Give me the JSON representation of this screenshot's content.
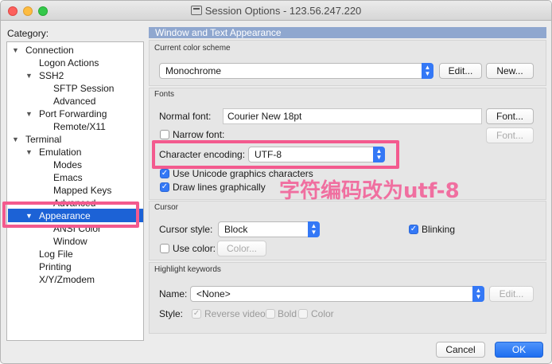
{
  "window": {
    "title": "Session Options - 123.56.247.220"
  },
  "category_label": "Category:",
  "tree": [
    {
      "label": "Connection",
      "arrow": "▼"
    },
    {
      "label": "Logon Actions",
      "arrow": ""
    },
    {
      "label": "SSH2",
      "arrow": "▼"
    },
    {
      "label": "SFTP Session",
      "arrow": ""
    },
    {
      "label": "Advanced",
      "arrow": ""
    },
    {
      "label": "Port Forwarding",
      "arrow": "▼"
    },
    {
      "label": "Remote/X11",
      "arrow": ""
    },
    {
      "label": "Terminal",
      "arrow": "▼"
    },
    {
      "label": "Emulation",
      "arrow": "▼"
    },
    {
      "label": "Modes",
      "arrow": ""
    },
    {
      "label": "Emacs",
      "arrow": ""
    },
    {
      "label": "Mapped Keys",
      "arrow": ""
    },
    {
      "label": "Advanced",
      "arrow": ""
    },
    {
      "label": "Appearance",
      "arrow": "▼",
      "selected": true
    },
    {
      "label": "ANSI Color",
      "arrow": ""
    },
    {
      "label": "Window",
      "arrow": ""
    },
    {
      "label": "Log File",
      "arrow": ""
    },
    {
      "label": "Printing",
      "arrow": ""
    },
    {
      "label": "X/Y/Zmodem",
      "arrow": ""
    }
  ],
  "panel": {
    "header": "Window and Text Appearance",
    "color_scheme": {
      "title": "Current color scheme",
      "value": "Monochrome",
      "edit_label": "Edit...",
      "new_label": "New..."
    },
    "fonts": {
      "title": "Fonts",
      "normal_font_label": "Normal font:",
      "normal_font_value": "Courier New 18pt",
      "font_button": "Font...",
      "narrow_font_label": "Narrow font:",
      "narrow_font_button": "Font...",
      "encoding_label": "Character encoding:",
      "encoding_value": "UTF-8",
      "unicode_graphics_label": "Use Unicode graphics characters",
      "draw_lines_label": "Draw lines graphically"
    },
    "cursor": {
      "title": "Cursor",
      "style_label": "Cursor style:",
      "style_value": "Block",
      "blinking_label": "Blinking",
      "use_color_label": "Use color:",
      "color_button": "Color..."
    },
    "highlight": {
      "title": "Highlight keywords",
      "name_label": "Name:",
      "name_value": "<None>",
      "edit_label": "Edit...",
      "style_label": "Style:",
      "reverse_video_label": "Reverse video",
      "bold_label": "Bold",
      "color_label": "Color"
    }
  },
  "footer": {
    "cancel_label": "Cancel",
    "ok_label": "OK"
  },
  "annotation": {
    "text": "字符编码改为utf-8"
  },
  "colors": {
    "accent": "#3478f6",
    "selection": "#1c62d6",
    "highlight": "#f35a8e",
    "header": "#8fa7cf"
  }
}
